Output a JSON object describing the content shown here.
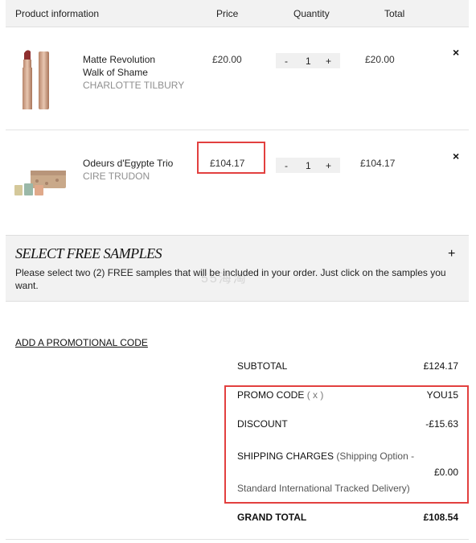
{
  "header": {
    "product_info": "Product information",
    "price": "Price",
    "quantity": "Quantity",
    "total": "Total"
  },
  "items": [
    {
      "name_line1": "Matte Revolution",
      "name_line2": "Walk of Shame",
      "brand": "CHARLOTTE TILBURY",
      "price": "£20.00",
      "qty": "1",
      "total": "£20.00"
    },
    {
      "name_line1": "Odeurs d'Egypte Trio",
      "brand": "CIRE TRUDON",
      "price": "£104.17",
      "qty": "1",
      "total": "£104.17"
    }
  ],
  "qty_controls": {
    "minus": "-",
    "plus": "+"
  },
  "remove_icon": "×",
  "samples": {
    "title": "SELECT FREE SAMPLES",
    "description": "Please select two (2) FREE samples that will be included in your order. Just click on the samples you want.",
    "expand": "+"
  },
  "watermark": "55海淘",
  "promo_link": "ADD A PROMOTIONAL CODE",
  "summary": {
    "subtotal_label": "SUBTOTAL",
    "subtotal_value": "£124.17",
    "promo_label": "PROMO CODE",
    "promo_remove": "( x )",
    "promo_value": "YOU15",
    "discount_label": "DISCOUNT",
    "discount_value": "-£15.63",
    "shipping_label": "SHIPPING CHARGES",
    "shipping_note_1": "(Shipping Option -",
    "shipping_note_2": "Standard International Tracked Delivery)",
    "shipping_value": "£0.00",
    "grand_label": "GRAND TOTAL",
    "grand_value": "£108.54"
  },
  "colors": {
    "highlight": "#e2403f",
    "panel": "#f2f2f2"
  }
}
